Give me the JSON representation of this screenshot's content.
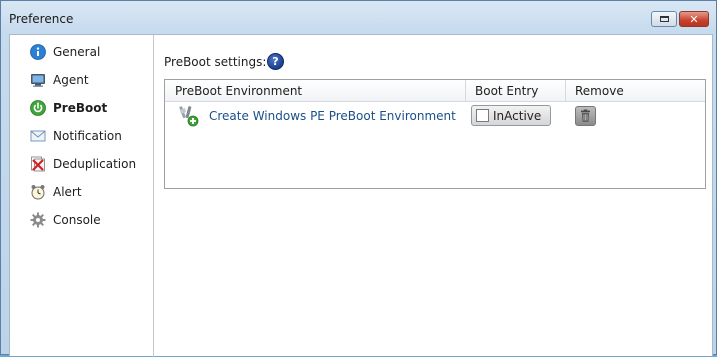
{
  "window": {
    "title": "Preference"
  },
  "sidebar": {
    "items": [
      {
        "label": "General",
        "icon": "info-icon",
        "active": false
      },
      {
        "label": "Agent",
        "icon": "computer-icon",
        "active": false
      },
      {
        "label": "PreBoot",
        "icon": "power-icon",
        "active": true
      },
      {
        "label": "Notification",
        "icon": "envelope-icon",
        "active": false
      },
      {
        "label": "Deduplication",
        "icon": "dedup-icon",
        "active": false
      },
      {
        "label": "Alert",
        "icon": "alarm-clock-icon",
        "active": false
      },
      {
        "label": "Console",
        "icon": "gear-icon",
        "active": false
      }
    ]
  },
  "main": {
    "settings_label": "PreBoot settings:",
    "help_icon": "?",
    "table": {
      "columns": [
        "PreBoot Environment",
        "Boot Entry",
        "Remove"
      ],
      "rows": [
        {
          "environment": "Create Windows PE PreBoot Environment",
          "boot_entry": "InActive",
          "remove_icon": "trash-icon"
        }
      ]
    }
  },
  "colors": {
    "link": "#1b4f8a",
    "close_button": "#c6422c",
    "titlebar": "#c7dbee"
  }
}
